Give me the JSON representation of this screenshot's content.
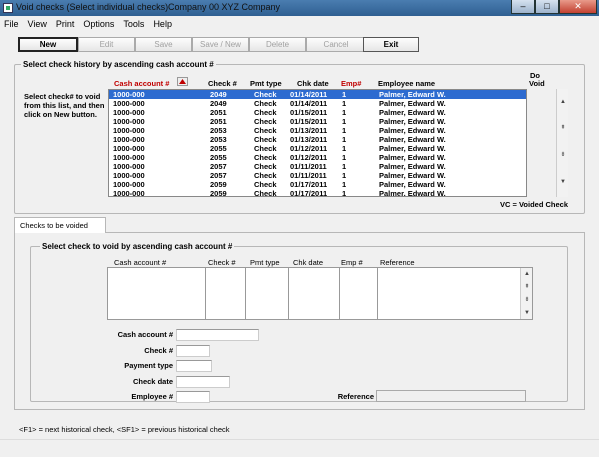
{
  "window": {
    "title": "Void checks (Select individual checks)",
    "company": "Company 00  XYZ Company",
    "minimize": "–",
    "maximize": "□",
    "close": "✕"
  },
  "menu": [
    "File",
    "View",
    "Print",
    "Options",
    "Tools",
    "Help"
  ],
  "toolbar": {
    "new": "New",
    "edit": "Edit",
    "save": "Save",
    "save_new": "Save / New",
    "delete": "Delete",
    "cancel": "Cancel",
    "exit": "Exit"
  },
  "history": {
    "group_title": "Select check history by ascending cash account #",
    "hint": "Select check# to void from this list, and then click on New button.",
    "columns": {
      "cash_account": "Cash account #",
      "check": "Check #",
      "pmt_type": "Pmt type",
      "chk_date": "Chk date",
      "emp": "Emp#",
      "employee_name": "Employee name",
      "do_void_1": "Do",
      "do_void_2": "Void"
    },
    "sort_icon": "sort-arrow-icon",
    "rows": [
      {
        "cash_account": "1000-000",
        "check": "2049",
        "pmt_type": "Check",
        "chk_date": "01/14/2011",
        "emp": "1",
        "employee_name": "Palmer, Edward W.",
        "selected": true
      },
      {
        "cash_account": "1000-000",
        "check": "2049",
        "pmt_type": "Check",
        "chk_date": "01/14/2011",
        "emp": "1",
        "employee_name": "Palmer, Edward W.",
        "selected": false
      },
      {
        "cash_account": "1000-000",
        "check": "2051",
        "pmt_type": "Check",
        "chk_date": "01/15/2011",
        "emp": "1",
        "employee_name": "Palmer, Edward W.",
        "selected": false
      },
      {
        "cash_account": "1000-000",
        "check": "2051",
        "pmt_type": "Check",
        "chk_date": "01/15/2011",
        "emp": "1",
        "employee_name": "Palmer, Edward W.",
        "selected": false
      },
      {
        "cash_account": "1000-000",
        "check": "2053",
        "pmt_type": "Check",
        "chk_date": "01/13/2011",
        "emp": "1",
        "employee_name": "Palmer, Edward W.",
        "selected": false
      },
      {
        "cash_account": "1000-000",
        "check": "2053",
        "pmt_type": "Check",
        "chk_date": "01/13/2011",
        "emp": "1",
        "employee_name": "Palmer, Edward W.",
        "selected": false
      },
      {
        "cash_account": "1000-000",
        "check": "2055",
        "pmt_type": "Check",
        "chk_date": "01/12/2011",
        "emp": "1",
        "employee_name": "Palmer, Edward W.",
        "selected": false
      },
      {
        "cash_account": "1000-000",
        "check": "2055",
        "pmt_type": "Check",
        "chk_date": "01/12/2011",
        "emp": "1",
        "employee_name": "Palmer, Edward W.",
        "selected": false
      },
      {
        "cash_account": "1000-000",
        "check": "2057",
        "pmt_type": "Check",
        "chk_date": "01/11/2011",
        "emp": "1",
        "employee_name": "Palmer, Edward W.",
        "selected": false
      },
      {
        "cash_account": "1000-000",
        "check": "2057",
        "pmt_type": "Check",
        "chk_date": "01/11/2011",
        "emp": "1",
        "employee_name": "Palmer, Edward W.",
        "selected": false
      },
      {
        "cash_account": "1000-000",
        "check": "2059",
        "pmt_type": "Check",
        "chk_date": "01/17/2011",
        "emp": "1",
        "employee_name": "Palmer, Edward W.",
        "selected": false
      },
      {
        "cash_account": "1000-000",
        "check": "2059",
        "pmt_type": "Check",
        "chk_date": "01/17/2011",
        "emp": "1",
        "employee_name": "Palmer, Edward W.",
        "selected": false
      }
    ],
    "legend": "VC = Voided Check"
  },
  "tabs": {
    "checks_to_be_voided": "Checks to be voided"
  },
  "void_section": {
    "group_title": "Select check to void by ascending cash account #",
    "columns": {
      "cash_account": "Cash account #",
      "check": "Check #",
      "pmt_type": "Pmt type",
      "chk_date": "Chk date",
      "emp": "Emp #",
      "reference": "Reference"
    },
    "fields": {
      "cash_account_label": "Cash account #",
      "check_label": "Check #",
      "payment_type_label": "Payment type",
      "check_date_label": "Check date",
      "employee_label": "Employee #",
      "reference_label": "Reference",
      "cash_account_value": "",
      "check_value": "",
      "payment_type_value": "",
      "check_date_value": "",
      "employee_value": "",
      "reference_value": ""
    }
  },
  "status": {
    "hint": "<F1> = next historical check, <SF1> = previous historical check"
  }
}
